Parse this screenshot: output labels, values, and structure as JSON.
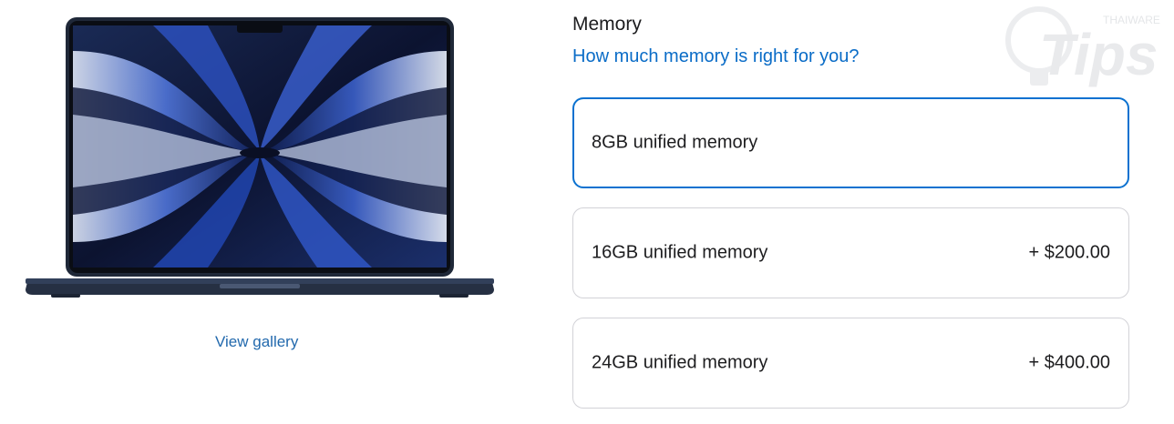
{
  "gallery": {
    "link_label": "View gallery"
  },
  "memory": {
    "title": "Memory",
    "help_link": "How much memory is right for you?",
    "options": [
      {
        "label": "8GB unified memory",
        "price": "",
        "selected": true
      },
      {
        "label": "16GB unified memory",
        "price": "+ $200.00",
        "selected": false
      },
      {
        "label": "24GB unified memory",
        "price": "+ $400.00",
        "selected": false
      }
    ]
  },
  "watermark": {
    "brand": "THAIWARE",
    "word": "Tips"
  },
  "colors": {
    "accent": "#0a71d0",
    "link": "#2269ad",
    "border": "#d2d2d7",
    "laptop_body": "#1c2433"
  }
}
